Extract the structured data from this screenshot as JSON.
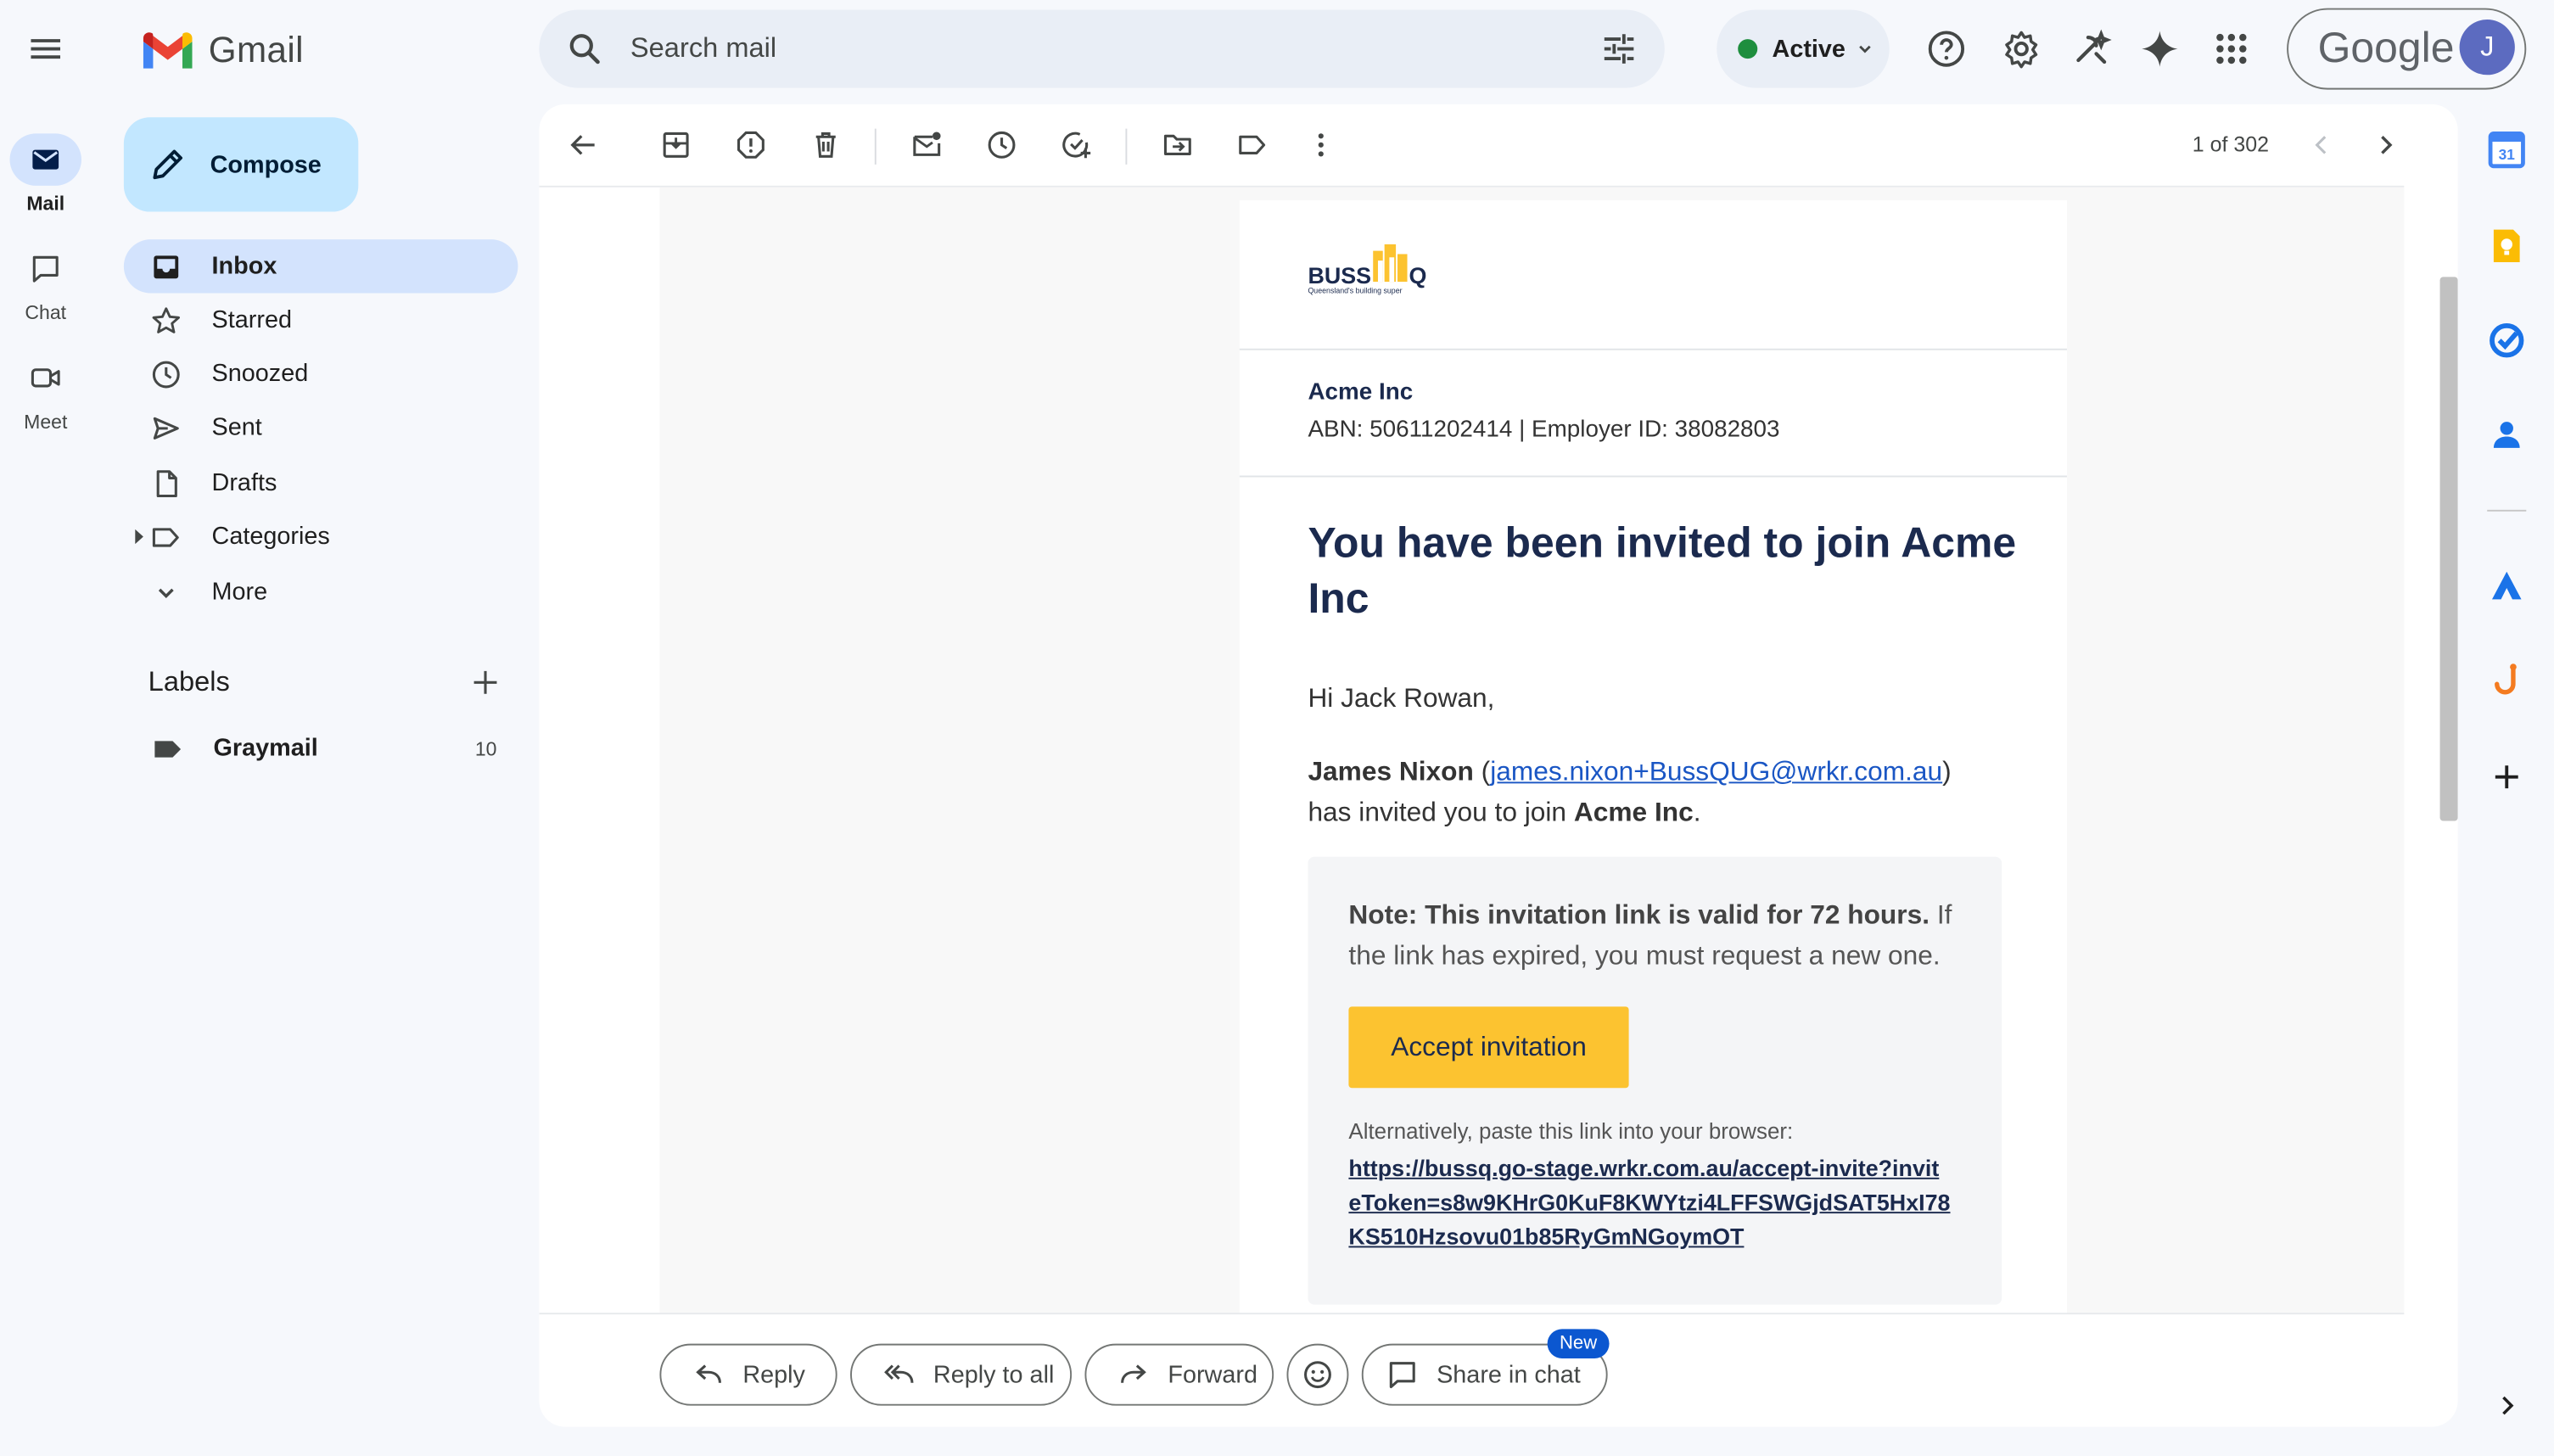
{
  "app": {
    "name": "Gmail"
  },
  "search": {
    "placeholder": "Search mail"
  },
  "status": {
    "label": "Active",
    "color": "#1e8e3e"
  },
  "account": {
    "brand": "Google",
    "avatar_letter": "J"
  },
  "rail": [
    {
      "label": "Mail",
      "icon": "mail-icon"
    },
    {
      "label": "Chat",
      "icon": "chat-icon"
    },
    {
      "label": "Meet",
      "icon": "video-icon"
    }
  ],
  "compose": {
    "label": "Compose"
  },
  "nav": [
    {
      "label": "Inbox",
      "icon": "inbox-icon",
      "selected": true
    },
    {
      "label": "Starred",
      "icon": "star-icon"
    },
    {
      "label": "Snoozed",
      "icon": "clock-icon"
    },
    {
      "label": "Sent",
      "icon": "send-icon"
    },
    {
      "label": "Drafts",
      "icon": "draft-icon"
    },
    {
      "label": "Categories",
      "icon": "label-icon"
    },
    {
      "label": "More",
      "icon": "chevron-down-icon"
    }
  ],
  "labels": {
    "title": "Labels",
    "items": [
      {
        "name": "Graymail",
        "count": "10"
      }
    ]
  },
  "pager": {
    "text": "1 of 302"
  },
  "email": {
    "logo_text": "BUSS",
    "logo_letter": "Q",
    "logo_tagline": "Queensland's building super",
    "employer_name": "Acme Inc",
    "employer_ids": "ABN: 50611202414 | Employer ID: 38082803",
    "heading": "You have been invited to join Acme Inc",
    "greeting": "Hi Jack Rowan,",
    "inviter_name": "James Nixon",
    "inviter_open": " (",
    "inviter_email": "james.nixon+BussQUG@wrkr.com.au",
    "inviter_close": ")",
    "invite_text": " has invited you to join ",
    "invite_company": "Acme Inc",
    "invite_end": ".",
    "note_bold": "Note: This invitation link is valid for 72 hours.",
    "note_rest": " If the link has expired, you must request a new one.",
    "accept_label": "Accept invitation",
    "alt_text": "Alternatively, paste this link into your browser:",
    "alt_link": "https://bussq.go-stage.wrkr.com.au/accept-invite?inviteToken=s8w9KHrG0KuF8KWYtzi4LFFSWGjdSAT5HxI78KS510Hzsovu01b85RyGmNGoymOT"
  },
  "actions": {
    "reply": "Reply",
    "reply_all": "Reply to all",
    "forward": "Forward",
    "share": "Share in chat",
    "new_badge": "New"
  },
  "colors": {
    "accent": "#0b57d0",
    "compose_bg": "#c2e7ff",
    "selected_bg": "#d3e3fd",
    "button_yellow": "#fcc330",
    "navy": "#1b2a4e"
  }
}
